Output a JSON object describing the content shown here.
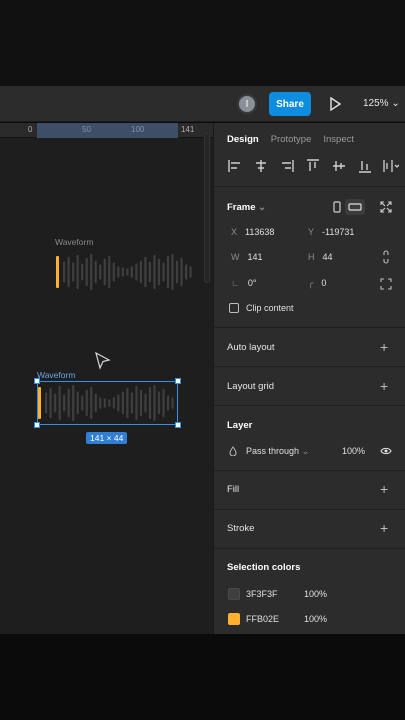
{
  "toolbar": {
    "avatar_initial": "I",
    "share_label": "Share",
    "zoom_label": "125%"
  },
  "canvas": {
    "ruler_labels": [
      "0",
      "50",
      "100",
      "141"
    ],
    "frame_label_top": "Waveform",
    "frame_label_selected": "Waveform",
    "selection_dims": "141 × 44"
  },
  "panel": {
    "tabs": [
      "Design",
      "Prototype",
      "Inspect"
    ],
    "frame": {
      "title": "Frame",
      "x_label": "X",
      "x_value": "113638",
      "y_label": "Y",
      "y_value": "-119731",
      "w_label": "W",
      "w_value": "141",
      "h_label": "H",
      "h_value": "44",
      "rotation_value": "0°",
      "radius_value": "0",
      "clip_content_label": "Clip content"
    },
    "auto_layout": "Auto layout",
    "layout_grid": "Layout grid",
    "layer": {
      "title": "Layer",
      "blend_mode": "Pass through",
      "opacity": "100%"
    },
    "fill": "Fill",
    "stroke": "Stroke",
    "selection_colors": {
      "title": "Selection colors",
      "items": [
        {
          "hex": "3F3F3F",
          "opacity": "100%",
          "color": "#3F3F3F"
        },
        {
          "hex": "FFB02E",
          "opacity": "100%",
          "color": "#FFB02E"
        }
      ]
    }
  },
  "colors": {
    "accent": "#0d8ce0",
    "selection": "#3591e6",
    "waveform_bar": "#3F3F3F",
    "playhead": "#FFB02E"
  }
}
